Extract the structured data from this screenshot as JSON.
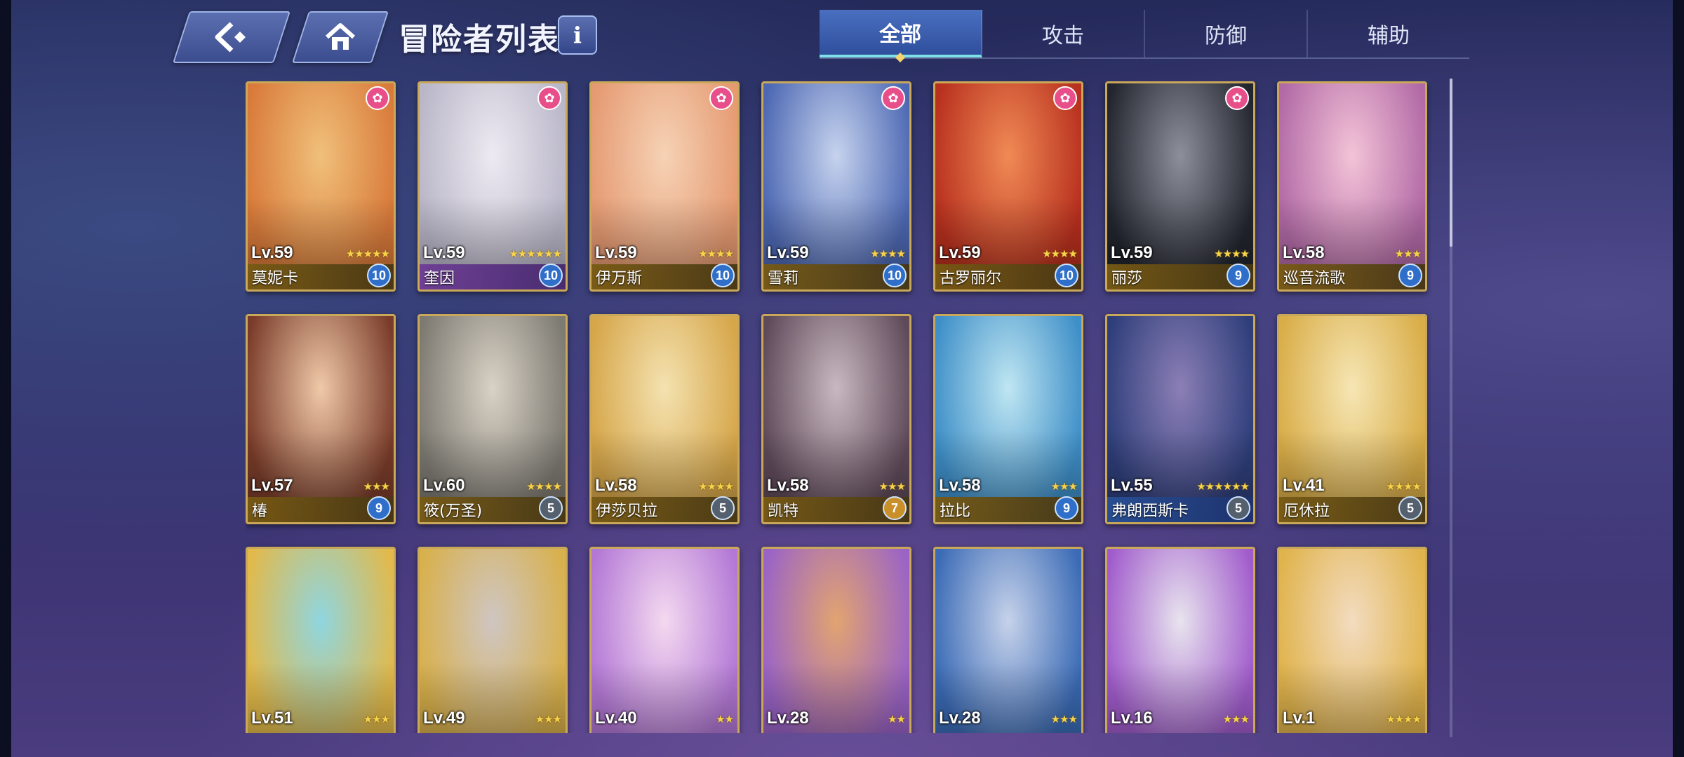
{
  "header": {
    "title": "冒险者列表",
    "info_label": "i",
    "back_icon": "back-arrow-icon",
    "home_icon": "home-icon"
  },
  "tabs": [
    {
      "label": "全部",
      "active": true
    },
    {
      "label": "攻击",
      "active": false
    },
    {
      "label": "防御",
      "active": false
    },
    {
      "label": "辅助",
      "active": false
    }
  ],
  "cards": [
    {
      "name": "莫妮卡",
      "level": "Lv.59",
      "stars": "★★★★★",
      "badge": "10",
      "paw": true,
      "art": [
        "#d97a3a",
        "#f0c07a"
      ]
    },
    {
      "name": "奎因",
      "level": "Lv.59",
      "stars": "★★★★★★",
      "badge": "10",
      "paw": true,
      "art": [
        "#b9b6c8",
        "#eeeaf2"
      ],
      "bar": "purple"
    },
    {
      "name": "伊万斯",
      "level": "Lv.59",
      "stars": "★★★★",
      "badge": "10",
      "paw": true,
      "art": [
        "#e59a72",
        "#f6d2b5"
      ]
    },
    {
      "name": "雪莉",
      "level": "Lv.59",
      "stars": "★★★★",
      "badge": "10",
      "paw": true,
      "art": [
        "#4d68b3",
        "#c6d3ee"
      ]
    },
    {
      "name": "古罗丽尔",
      "level": "Lv.59",
      "stars": "★★★★",
      "badge": "10",
      "paw": true,
      "art": [
        "#b8301e",
        "#f08a55"
      ]
    },
    {
      "name": "丽莎",
      "level": "Lv.59",
      "stars": "★★★★",
      "badge": "9",
      "paw": true,
      "art": [
        "#22252e",
        "#8d8f9b"
      ]
    },
    {
      "name": "巡音流歌",
      "level": "Lv.58",
      "stars": "★★★",
      "badge": "9",
      "paw": false,
      "art": [
        "#b26aa6",
        "#f3c3d7"
      ]
    },
    {
      "name": "椿",
      "level": "Lv.57",
      "stars": "★★★",
      "badge": "9",
      "paw": false,
      "art": [
        "#7a3c2a",
        "#f0c9a8"
      ]
    },
    {
      "name": "筱(万圣)",
      "level": "Lv.60",
      "stars": "★★★★",
      "badge": "5",
      "badge_style": "grey",
      "paw": false,
      "art": [
        "#7d7a72",
        "#d9d2c6"
      ]
    },
    {
      "name": "伊莎贝拉",
      "level": "Lv.58",
      "stars": "★★★★",
      "badge": "5",
      "badge_style": "grey",
      "paw": false,
      "art": [
        "#d6a64a",
        "#f4e2b0"
      ]
    },
    {
      "name": "凯特",
      "level": "Lv.58",
      "stars": "★★★",
      "badge": "7",
      "badge_style": "gold",
      "paw": false,
      "art": [
        "#5f4a5a",
        "#c9b8c0"
      ]
    },
    {
      "name": "拉比",
      "level": "Lv.58",
      "stars": "★★★",
      "badge": "9",
      "paw": false,
      "art": [
        "#3e8fc8",
        "#bfe6f2"
      ]
    },
    {
      "name": "弗朗西斯卡",
      "level": "Lv.55",
      "stars": "★★★★★★",
      "badge": "5",
      "badge_style": "grey",
      "paw": false,
      "art": [
        "#2e3e7a",
        "#8c7fb6"
      ],
      "bar": "blue"
    },
    {
      "name": "厄休拉",
      "level": "Lv.41",
      "stars": "★★★★",
      "badge": "5",
      "badge_style": "grey",
      "paw": false,
      "art": [
        "#d9ad48",
        "#f6e6b4"
      ]
    },
    {
      "name": "",
      "level": "Lv.51",
      "stars": "★★★",
      "badge": "",
      "paw": false,
      "art": [
        "#e2b94a",
        "#8fd6e0"
      ]
    },
    {
      "name": "",
      "level": "Lv.49",
      "stars": "★★★",
      "badge": "",
      "paw": false,
      "art": [
        "#d8b04c",
        "#cfc6c2"
      ]
    },
    {
      "name": "",
      "level": "Lv.40",
      "stars": "★★",
      "badge": "",
      "paw": false,
      "art": [
        "#b378d6",
        "#f4d9f0"
      ]
    },
    {
      "name": "",
      "level": "Lv.28",
      "stars": "★★",
      "badge": "",
      "paw": false,
      "art": [
        "#9a63c6",
        "#e2a470"
      ]
    },
    {
      "name": "",
      "level": "Lv.28",
      "stars": "★★★",
      "badge": "",
      "paw": false,
      "art": [
        "#3b6bb6",
        "#c6d2ea"
      ]
    },
    {
      "name": "",
      "level": "Lv.16",
      "stars": "★★★",
      "badge": "",
      "paw": false,
      "art": [
        "#a15ccc",
        "#e8e4ee"
      ]
    },
    {
      "name": "",
      "level": "Lv.1",
      "stars": "★★★★",
      "badge": "",
      "paw": false,
      "art": [
        "#e0b34c",
        "#f3dcc0"
      ]
    }
  ]
}
